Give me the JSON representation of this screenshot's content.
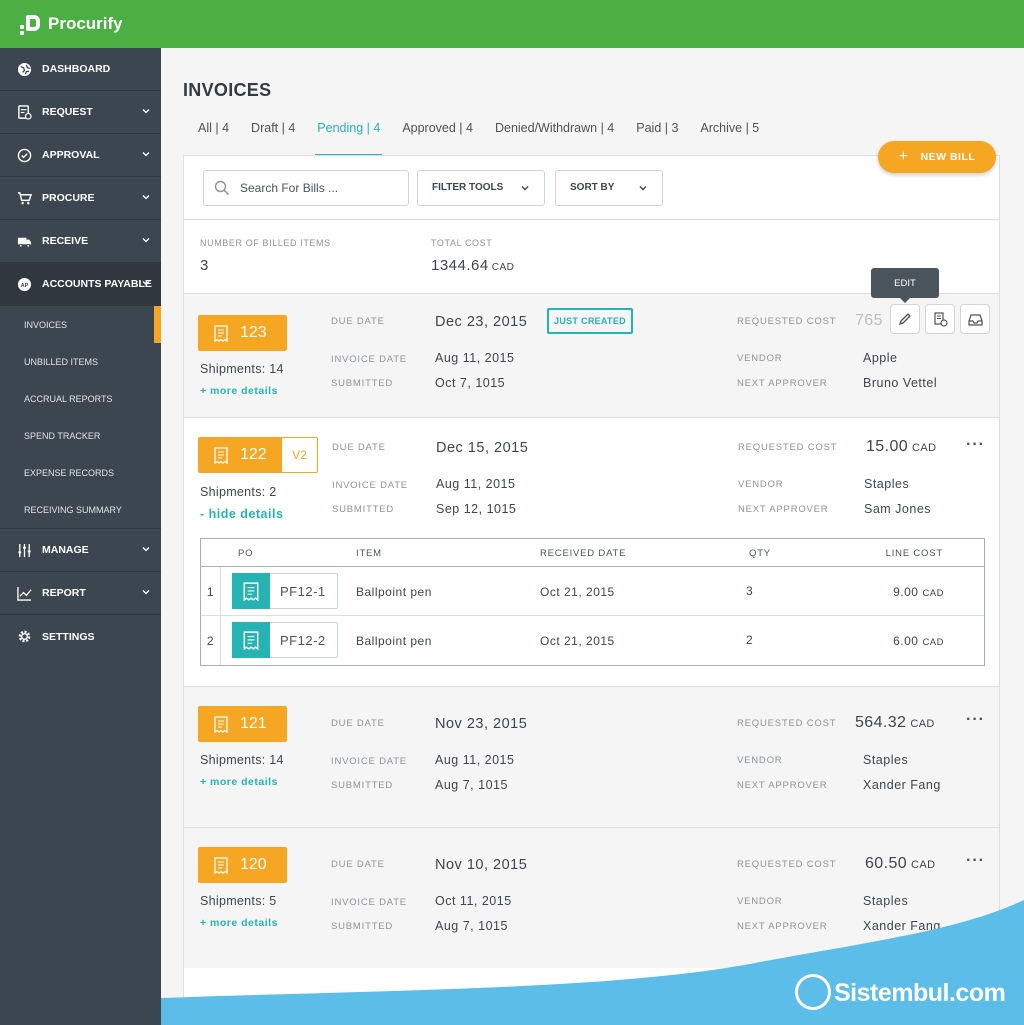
{
  "app": {
    "name": "Procurify"
  },
  "sidebar": {
    "items": [
      {
        "label": "DASHBOARD",
        "icon": "globe-icon"
      },
      {
        "label": "REQUEST",
        "icon": "request-icon"
      },
      {
        "label": "APPROVAL",
        "icon": "check-circle-icon"
      },
      {
        "label": "PROCURE",
        "icon": "cart-icon"
      },
      {
        "label": "RECEIVE",
        "icon": "truck-icon"
      },
      {
        "label": "ACCOUNTS PAYABLE",
        "icon": "ap-icon"
      }
    ],
    "sub_items": [
      {
        "label": "INVOICES"
      },
      {
        "label": "UNBILLED ITEMS"
      },
      {
        "label": "ACCRUAL REPORTS"
      },
      {
        "label": "SPEND TRACKER"
      },
      {
        "label": "EXPENSE RECORDS"
      },
      {
        "label": "RECEIVING SUMMARY"
      }
    ],
    "bottom_items": [
      {
        "label": "MANAGE",
        "icon": "sliders-icon"
      },
      {
        "label": "REPORT",
        "icon": "chart-icon"
      },
      {
        "label": "SETTINGS",
        "icon": "gear-icon"
      }
    ]
  },
  "page": {
    "title": "INVOICES"
  },
  "tabs": [
    {
      "label": "All  |  4"
    },
    {
      "label": "Draft  |  4"
    },
    {
      "label": "Pending  |  4"
    },
    {
      "label": "Approved  |  4"
    },
    {
      "label": "Denied/Withdrawn  |  4"
    },
    {
      "label": "Paid  |  3"
    },
    {
      "label": "Archive  |  5"
    }
  ],
  "toolbar": {
    "search_placeholder": "Search For Bills ...",
    "filter_label": "FILTER TOOLS",
    "sort_label": "SORT BY",
    "new_bill_label": "NEW BILL",
    "new_bill_plus": "+"
  },
  "summary": {
    "items_label": "NUMBER OF BILLED ITEMS",
    "items_value": "3",
    "cost_label": "TOTAL COST",
    "cost_value": "1344.64",
    "cost_currency": "CAD"
  },
  "labels": {
    "due_date": "DUE DATE",
    "invoice_date": "INVOICE DATE",
    "submitted": "SUBMITTED",
    "requested_cost": "REQUESTED COST",
    "vendor": "VENDOR",
    "next_approver": "NEXT APPROVER",
    "currency": "CAD",
    "more_options": "···"
  },
  "bills": [
    {
      "id": "123",
      "shipments": "Shipments: 14",
      "toggle": "+ more details",
      "due_date": "Dec 23, 2015",
      "invoice_date": "Aug 11, 2015",
      "submitted": "Oct 7, 1015",
      "cost": "765",
      "vendor": "Apple",
      "approver": "Bruno Vettel",
      "status_badge": "JUST CREATED",
      "tooltip": "EDIT"
    },
    {
      "id": "122",
      "version": "V2",
      "shipments": "Shipments: 2",
      "toggle": "- hide details",
      "due_date": "Dec 15, 2015",
      "invoice_date": "Aug 11, 2015",
      "submitted": "Sep 12, 1015",
      "cost": "15.00",
      "vendor": "Staples",
      "approver": "Sam Jones"
    },
    {
      "id": "121",
      "shipments": "Shipments: 14",
      "toggle": "+ more details",
      "due_date": "Nov 23, 2015",
      "invoice_date": "Aug 11, 2015",
      "submitted": "Aug 7, 1015",
      "cost": "564.32",
      "vendor": "Staples",
      "approver": "Xander Fang"
    },
    {
      "id": "120",
      "shipments": "Shipments: 5",
      "toggle": "+ more details",
      "due_date": "Nov 10, 2015",
      "invoice_date": "Oct 11, 2015",
      "submitted": "Aug 7, 1015",
      "cost": "60.50",
      "vendor": "Staples",
      "approver": "Xander Fang"
    }
  ],
  "line_items": {
    "headers": {
      "po": "PO",
      "item": "ITEM",
      "received": "RECEIVED DATE",
      "qty": "QTY",
      "line_cost": "LINE COST"
    },
    "rows": [
      {
        "idx": "1",
        "po": "PF12-1",
        "item": "Ballpoint pen",
        "received": "Oct 21, 2015",
        "qty": "3",
        "cost": "9.00",
        "currency": "CAD"
      },
      {
        "idx": "2",
        "po": "PF12-2",
        "item": "Ballpoint pen",
        "received": "Oct 21, 2015",
        "qty": "2",
        "cost": "6.00",
        "currency": "CAD"
      }
    ]
  },
  "watermark": {
    "text": "Sistembul.com"
  },
  "colors": {
    "brand_green": "#4caf44",
    "accent_orange": "#f5a623",
    "teal": "#26b3b3",
    "sidebar": "#3c4650",
    "watermark_blue": "#5bbde8"
  }
}
